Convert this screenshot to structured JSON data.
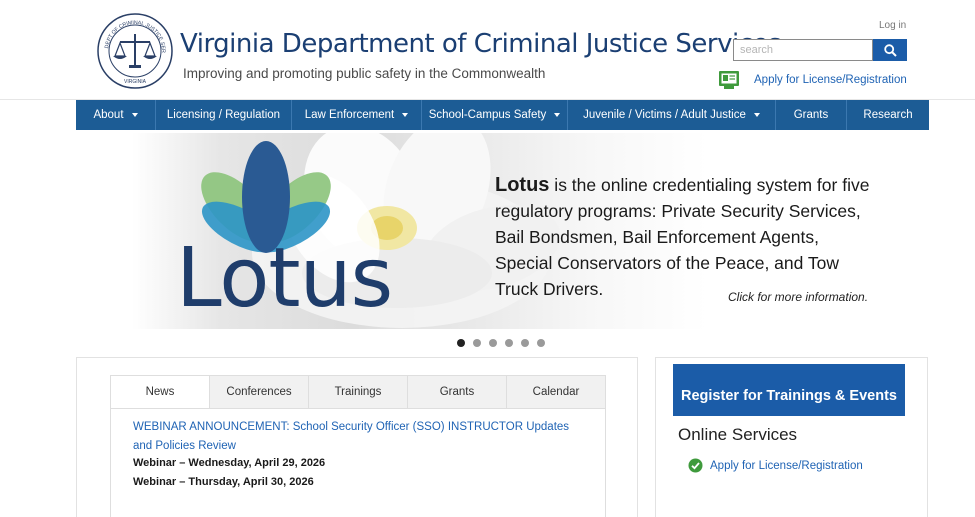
{
  "header": {
    "title": "Virginia Department of Criminal Justice Services",
    "tagline": "Improving and promoting public safety in the Commonwealth",
    "login": "Log in",
    "search_placeholder": "search",
    "apply_link": "Apply for License/Registration",
    "seal_text": "DEPARTMENT OF CRIMINAL JUSTICE SERVICES · VIRGINIA"
  },
  "nav": {
    "items": [
      {
        "label": "About",
        "has_menu": true
      },
      {
        "label": "Licensing / Regulation",
        "has_menu": false
      },
      {
        "label": "Law Enforcement",
        "has_menu": true
      },
      {
        "label": "School-Campus Safety",
        "has_menu": true
      },
      {
        "label": "Juvenile / Victims / Adult Justice",
        "has_menu": true
      },
      {
        "label": "Grants",
        "has_menu": false
      },
      {
        "label": "Research",
        "has_menu": false
      }
    ]
  },
  "banner": {
    "logo_word": "Lotus",
    "lead_word": "Lotus",
    "text": " is the online credentialing system for five regulatory programs: Private Security Services, Bail Bondsmen, Bail Enforcement Agents, Special Conservators of the Peace, and Tow Truck Drivers.",
    "more": "Click for more information.",
    "slide_count": 6,
    "active_slide": 1
  },
  "news": {
    "tabs": [
      "News",
      "Conferences",
      "Trainings",
      "Grants",
      "Calendar"
    ],
    "active_tab": "News",
    "headline": "WEBINAR ANNOUNCEMENT: School Security Officer (SSO) INSTRUCTOR Updates and Policies Review",
    "lines": [
      "Webinar – Wednesday, April 29, 2026",
      "Webinar – Thursday, April 30, 2026"
    ]
  },
  "sidebar": {
    "register_button": "Register for Trainings & Events",
    "online_title": "Online Services",
    "links": [
      "Apply for License/Registration"
    ]
  },
  "colors": {
    "brand_blue": "#1b5ca8",
    "nav_blue": "#1c5c95",
    "title_navy": "#1b3f73",
    "link_blue": "#1f63b4",
    "check_green": "#3f9a3c"
  }
}
